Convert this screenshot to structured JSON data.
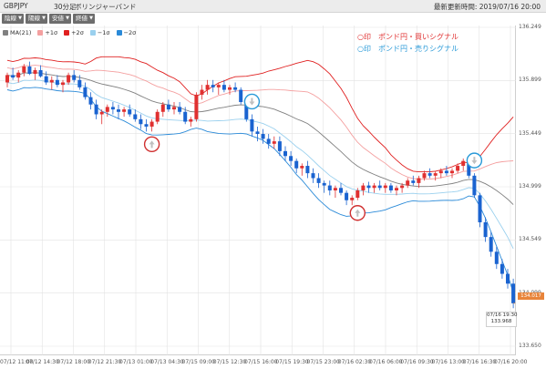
{
  "header": {
    "symbol": "GBPJPY",
    "timeframe": "30分足",
    "indicator_name": "ボリンジャーバンド",
    "last_updated": "最新更新時間: 2019/07/16 20:00"
  },
  "toolbar": {
    "buttons": [
      "陰線",
      "陽線",
      "安値",
      "終値"
    ]
  },
  "legend": [
    {
      "label": "MA(21)",
      "color": "#808080"
    },
    {
      "label": "+1σ",
      "color": "#f4a0a0"
    },
    {
      "label": "+2σ",
      "color": "#e02020"
    },
    {
      "label": "−1σ",
      "color": "#9ad0ee"
    },
    {
      "label": "−2σ",
      "color": "#2a8ad8"
    }
  ],
  "annotations": {
    "buy": "○印　ポンド円・買いシグナル",
    "sell": "○印　ポンド円・売りシグナル"
  },
  "colors": {
    "up": "#e03030",
    "down": "#1a63d0",
    "ma": "#808080",
    "upper1": "#f4a0a0",
    "upper2": "#e02020",
    "lower1": "#9ad0ee",
    "lower2": "#2a8ad8",
    "grid": "#e2e2e2",
    "buy_circle": "#d03030",
    "sell_circle": "#2a9ad8"
  },
  "current_price": "134.017",
  "cursor": {
    "time": "07/16 19:30",
    "price": "133.968"
  },
  "chart_data": {
    "type": "line",
    "title": "",
    "y_ticks": [
      "136.249",
      "135.899",
      "135.449",
      "134.999",
      "134.549",
      "134.099",
      "133.650"
    ],
    "x_ticks": [
      "07/12 11:00",
      "07/12 14:30",
      "07/12 18:00",
      "07/12 21:30",
      "07/13 01:00",
      "07/13 04:30",
      "07/15 09:00",
      "07/15 12:30",
      "07/15 16:00",
      "07/15 19:30",
      "07/15 23:00",
      "07/16 02:30",
      "07/16 06:00",
      "07/16 09:30",
      "07/16 13:00",
      "07/16 16:30",
      "07/16 20:00"
    ],
    "ylim": [
      133.65,
      136.249
    ],
    "candles": [
      [
        135.8,
        135.88,
        135.76,
        135.86
      ],
      [
        135.86,
        135.92,
        135.82,
        135.84
      ],
      [
        135.84,
        135.9,
        135.8,
        135.88
      ],
      [
        135.88,
        135.95,
        135.85,
        135.93
      ],
      [
        135.93,
        135.97,
        135.86,
        135.87
      ],
      [
        135.87,
        135.92,
        135.82,
        135.9
      ],
      [
        135.9,
        135.94,
        135.84,
        135.85
      ],
      [
        135.85,
        135.89,
        135.78,
        135.8
      ],
      [
        135.8,
        135.85,
        135.74,
        135.82
      ],
      [
        135.82,
        135.86,
        135.76,
        135.78
      ],
      [
        135.78,
        135.82,
        135.72,
        135.8
      ],
      [
        135.8,
        135.88,
        135.78,
        135.86
      ],
      [
        135.86,
        135.9,
        135.8,
        135.82
      ],
      [
        135.82,
        135.86,
        135.74,
        135.76
      ],
      [
        135.76,
        135.8,
        135.66,
        135.68
      ],
      [
        135.68,
        135.72,
        135.58,
        135.62
      ],
      [
        135.62,
        135.66,
        135.5,
        135.54
      ],
      [
        135.54,
        135.58,
        135.46,
        135.56
      ],
      [
        135.56,
        135.62,
        135.52,
        135.6
      ],
      [
        135.6,
        135.64,
        135.54,
        135.58
      ],
      [
        135.58,
        135.62,
        135.5,
        135.56
      ],
      [
        135.56,
        135.6,
        135.52,
        135.58
      ],
      [
        135.58,
        135.62,
        135.52,
        135.54
      ],
      [
        135.54,
        135.58,
        135.48,
        135.5
      ],
      [
        135.5,
        135.54,
        135.42,
        135.46
      ],
      [
        135.46,
        135.5,
        135.4,
        135.44
      ],
      [
        135.44,
        135.5,
        135.4,
        135.48
      ],
      [
        135.48,
        135.58,
        135.46,
        135.56
      ],
      [
        135.56,
        135.64,
        135.52,
        135.62
      ],
      [
        135.62,
        135.66,
        135.56,
        135.58
      ],
      [
        135.58,
        135.64,
        135.54,
        135.6
      ],
      [
        135.6,
        135.64,
        135.54,
        135.56
      ],
      [
        135.56,
        135.6,
        135.46,
        135.48
      ],
      [
        135.48,
        135.52,
        135.44,
        135.5
      ],
      [
        135.5,
        135.72,
        135.48,
        135.7
      ],
      [
        135.7,
        135.78,
        135.66,
        135.74
      ],
      [
        135.74,
        135.82,
        135.7,
        135.78
      ],
      [
        135.78,
        135.82,
        135.72,
        135.76
      ],
      [
        135.76,
        135.8,
        135.7,
        135.78
      ],
      [
        135.78,
        135.82,
        135.72,
        135.74
      ],
      [
        135.74,
        135.78,
        135.7,
        135.76
      ],
      [
        135.76,
        135.8,
        135.72,
        135.74
      ],
      [
        135.74,
        135.76,
        135.62,
        135.64
      ],
      [
        135.64,
        135.66,
        135.48,
        135.5
      ],
      [
        135.5,
        135.54,
        135.36,
        135.4
      ],
      [
        135.4,
        135.44,
        135.32,
        135.38
      ],
      [
        135.38,
        135.42,
        135.3,
        135.34
      ],
      [
        135.34,
        135.38,
        135.26,
        135.3
      ],
      [
        135.3,
        135.36,
        135.26,
        135.32
      ],
      [
        135.32,
        135.36,
        135.2,
        135.24
      ],
      [
        135.24,
        135.28,
        135.16,
        135.2
      ],
      [
        135.2,
        135.24,
        135.12,
        135.16
      ],
      [
        135.16,
        135.18,
        135.06,
        135.1
      ],
      [
        135.1,
        135.14,
        135.04,
        135.12
      ],
      [
        135.12,
        135.16,
        135.02,
        135.06
      ],
      [
        135.06,
        135.1,
        134.98,
        135.02
      ],
      [
        135.02,
        135.06,
        134.94,
        134.98
      ],
      [
        134.98,
        135.0,
        134.9,
        134.96
      ],
      [
        134.96,
        135.0,
        134.88,
        134.92
      ],
      [
        134.92,
        134.96,
        134.86,
        134.94
      ],
      [
        134.94,
        134.98,
        134.88,
        134.9
      ],
      [
        134.9,
        134.92,
        134.8,
        134.84
      ],
      [
        134.84,
        134.88,
        134.8,
        134.86
      ],
      [
        134.86,
        134.94,
        134.84,
        134.92
      ],
      [
        134.92,
        134.98,
        134.88,
        134.96
      ],
      [
        134.96,
        134.99,
        134.9,
        134.94
      ],
      [
        134.94,
        134.98,
        134.9,
        134.96
      ],
      [
        134.96,
        135.0,
        134.92,
        134.94
      ],
      [
        134.94,
        134.98,
        134.9,
        134.96
      ],
      [
        134.96,
        134.98,
        134.9,
        134.92
      ],
      [
        134.92,
        134.96,
        134.88,
        134.94
      ],
      [
        134.94,
        134.98,
        134.9,
        134.96
      ],
      [
        134.96,
        135.02,
        134.94,
        135.0
      ],
      [
        135.0,
        135.04,
        134.96,
        134.98
      ],
      [
        134.98,
        135.04,
        134.94,
        135.02
      ],
      [
        135.02,
        135.08,
        135.0,
        135.06
      ],
      [
        135.06,
        135.1,
        135.02,
        135.04
      ],
      [
        135.04,
        135.08,
        135.0,
        135.06
      ],
      [
        135.06,
        135.1,
        135.02,
        135.08
      ],
      [
        135.08,
        135.12,
        135.04,
        135.06
      ],
      [
        135.06,
        135.1,
        135.02,
        135.08
      ],
      [
        135.08,
        135.14,
        135.06,
        135.12
      ],
      [
        135.12,
        135.18,
        135.08,
        135.16
      ],
      [
        135.16,
        135.2,
        135.02,
        135.04
      ],
      [
        135.04,
        135.06,
        134.86,
        134.88
      ],
      [
        134.88,
        134.9,
        134.62,
        134.66
      ],
      [
        134.66,
        134.7,
        134.5,
        134.54
      ],
      [
        134.54,
        134.58,
        134.38,
        134.42
      ],
      [
        134.42,
        134.46,
        134.28,
        134.32
      ],
      [
        134.32,
        134.36,
        134.2,
        134.24
      ],
      [
        134.24,
        134.28,
        134.12,
        134.16
      ],
      [
        134.16,
        134.2,
        133.96,
        134.0
      ]
    ]
  }
}
